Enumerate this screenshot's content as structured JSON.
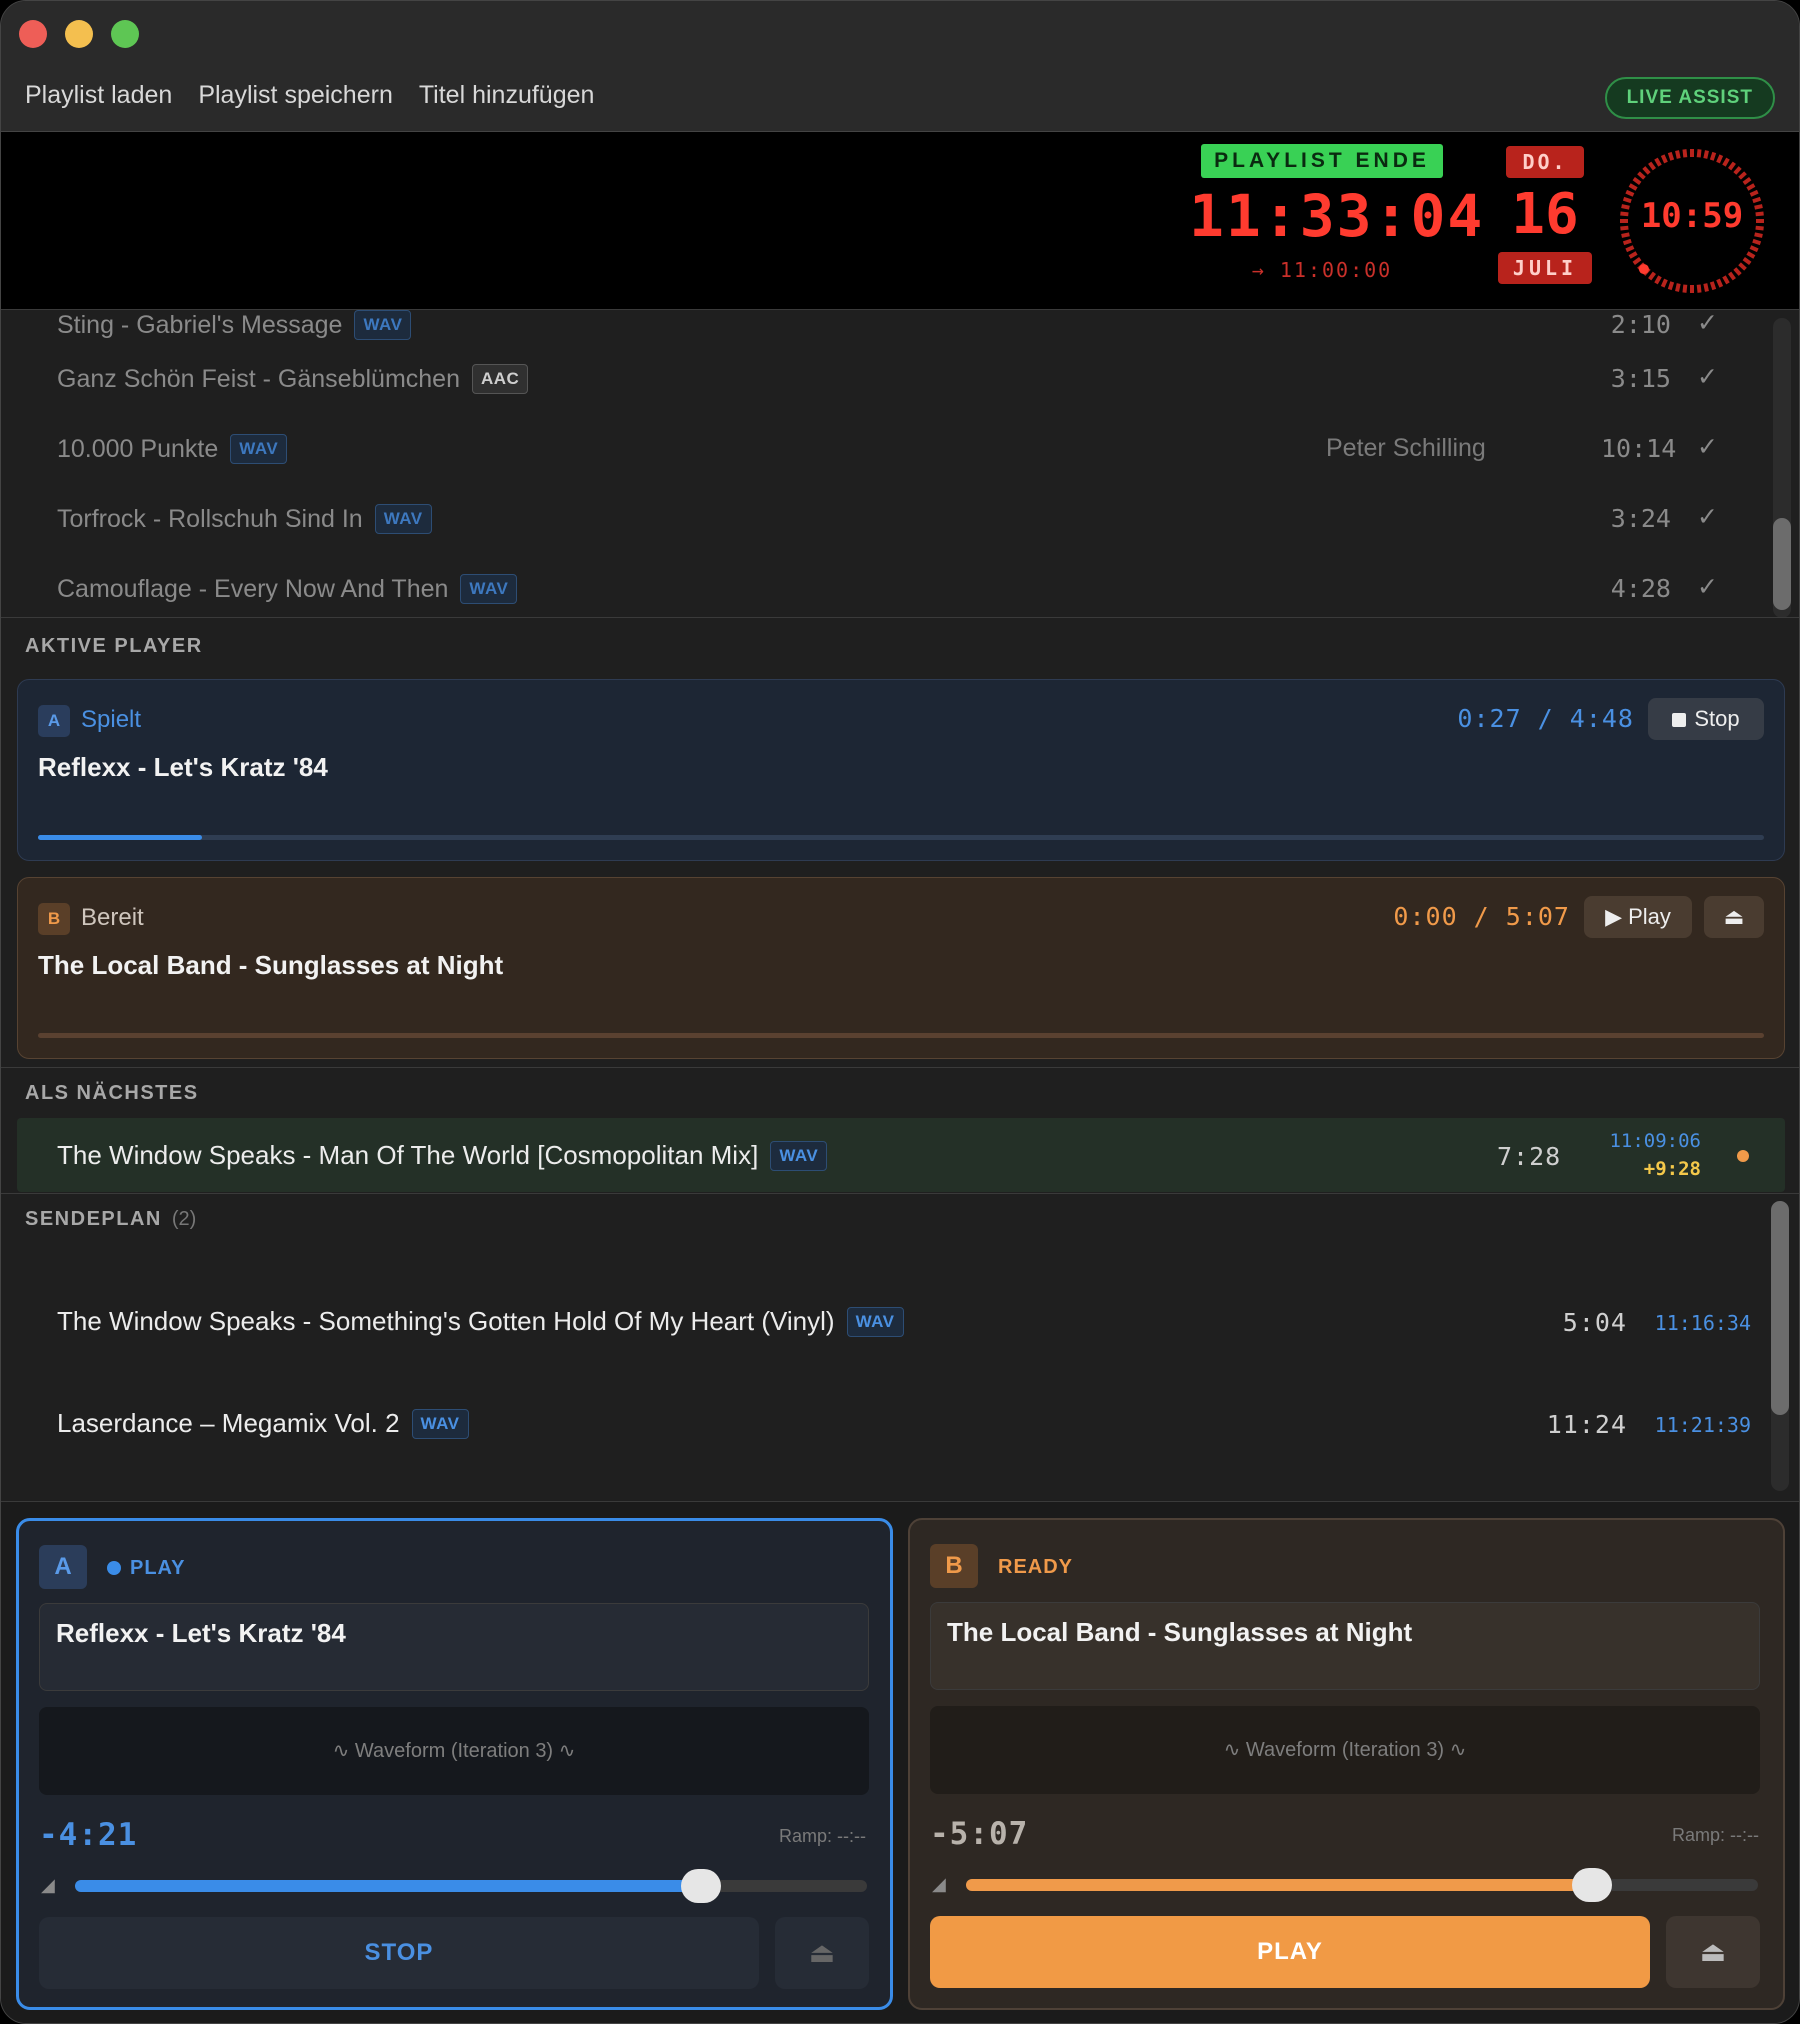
{
  "menu": {
    "items": [
      "Playlist laden",
      "Playlist speichern",
      "Titel hinzufügen"
    ],
    "live_assist": "LIVE ASSIST"
  },
  "clock": {
    "playlist_end_label": "PLAYLIST ENDE",
    "playlist_end_time": "11:33:04",
    "playlist_start": "→ 11:00:00",
    "day_short": "DO.",
    "day_number": "16",
    "month": "JULI",
    "current_time": "10:59"
  },
  "playlist": {
    "rows": [
      {
        "title": "Sting - Gabriel's Message",
        "format": "WAV",
        "artist": "",
        "duration": "2:10",
        "check": "✓"
      },
      {
        "title": "Ganz Schön Feist - Gänseblümchen",
        "format": "AAC",
        "artist": "",
        "duration": "3:15",
        "check": "✓"
      },
      {
        "title": "10.000 Punkte",
        "format": "WAV",
        "artist": "Peter Schilling",
        "duration": "10:14",
        "check": "✓"
      },
      {
        "title": "Torfrock - Rollschuh Sind In",
        "format": "WAV",
        "artist": "",
        "duration": "3:24",
        "check": "✓"
      },
      {
        "title": "Camouflage - Every Now And Then",
        "format": "WAV",
        "artist": "",
        "duration": "4:28",
        "check": "✓"
      }
    ]
  },
  "active_players": {
    "label": "AKTIVE PLAYER",
    "a": {
      "letter": "A",
      "state": "Spielt",
      "title": "Reflexx - Let's Kratz '84",
      "time": "0:27 / 4:48",
      "button": "Stop",
      "progress": 0.095
    },
    "b": {
      "letter": "B",
      "state": "Bereit",
      "title": "The Local Band - Sunglasses at Night",
      "time": "0:00 / 5:07",
      "button": "Play",
      "eject": "⏏",
      "progress": 0
    }
  },
  "next": {
    "label": "ALS NÄCHSTES",
    "title": "The Window Speaks - Man Of The World [Cosmopolitan Mix]",
    "format": "WAV",
    "duration": "7:28",
    "start": "11:09:06",
    "offset": "+9:28"
  },
  "schedule": {
    "label": "SENDEPLAN",
    "count": "(2)",
    "rows": [
      {
        "title": "The Window Speaks - Something's Gotten Hold Of My Heart (Vinyl)",
        "format": "WAV",
        "duration": "5:04",
        "start": "11:16:34"
      },
      {
        "title": "Laserdance – Megamix Vol. 2",
        "format": "WAV",
        "duration": "11:24",
        "start": "11:21:39"
      }
    ]
  },
  "decks": {
    "a": {
      "letter": "A",
      "state": "PLAY",
      "title": "Reflexx - Let's Kratz '84",
      "waveform": "∿ Waveform (Iteration 3) ∿",
      "remaining": "-4:21",
      "ramp": "Ramp: --:--",
      "volume": 0.79,
      "button": "STOP",
      "eject": "⏏"
    },
    "b": {
      "letter": "B",
      "state": "READY",
      "title": "The Local Band - Sunglasses at Night",
      "waveform": "∿ Waveform (Iteration 3) ∿",
      "remaining": "-5:07",
      "ramp": "Ramp: --:--",
      "volume": 0.79,
      "button": "PLAY",
      "eject": "⏏"
    }
  },
  "colors": {
    "accent_blue": "#3a8ce8",
    "accent_orange": "#f09a4a",
    "clock_red": "#ff3b2f",
    "live_green": "#5fd17b"
  },
  "icons": {
    "stop": "stop-square-icon",
    "play": "play-triangle-icon",
    "eject": "eject-icon",
    "volume": "speaker-icon",
    "check": "checkmark-icon"
  }
}
